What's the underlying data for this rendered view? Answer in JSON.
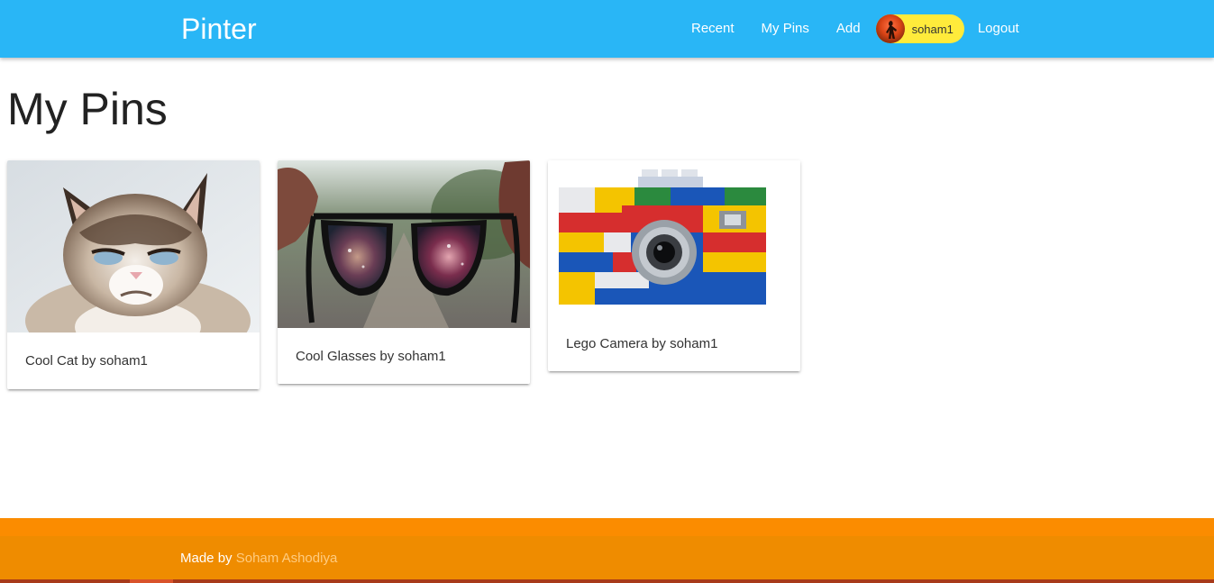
{
  "navbar": {
    "brand": "Pinter",
    "links": [
      {
        "label": "Recent"
      },
      {
        "label": "My Pins"
      },
      {
        "label": "Add"
      }
    ],
    "user": {
      "name": "soham1"
    },
    "logout_label": "Logout",
    "colors": {
      "background": "#29b6f6",
      "chip": "#ffeb3b"
    }
  },
  "main": {
    "title": "My Pins",
    "pins": [
      {
        "caption": "Cool Cat by soham1",
        "image": "grumpy-cat-photo"
      },
      {
        "caption": "Cool Glasses by soham1",
        "image": "sunglasses-photo"
      },
      {
        "caption": "Lego Camera by soham1",
        "image": "lego-camera-photo"
      }
    ]
  },
  "footer": {
    "made_by": "Made by",
    "author": "Soham Ashodiya",
    "colors": {
      "top": "#fb8c00",
      "main": "#ef8c00",
      "bottom": "#a83a1a"
    }
  }
}
